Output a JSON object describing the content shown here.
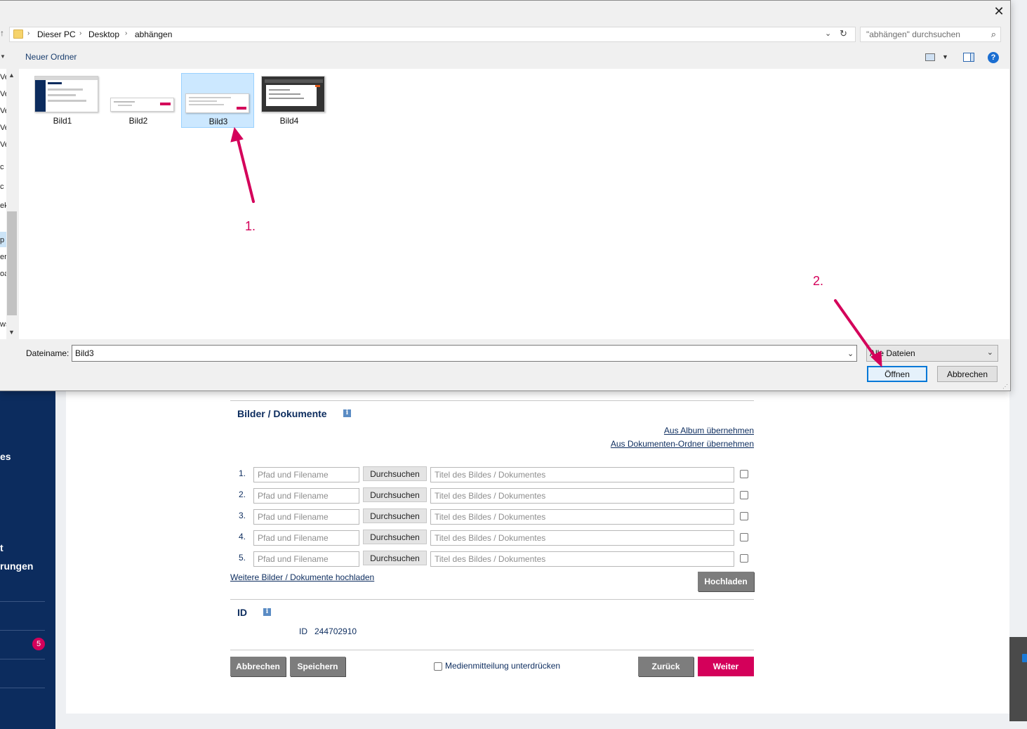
{
  "dialog": {
    "close_glyph": "✕",
    "breadcrumb": [
      "Dieser PC",
      "Desktop",
      "abhängen"
    ],
    "search_placeholder": "\"abhängen\" durchsuchen",
    "new_folder": "Neuer Ordner",
    "help_glyph": "?",
    "sidebar_fragments": [
      "Ve",
      "Ve",
      "Ve",
      "Ve",
      "Ve",
      "c -",
      "c",
      "ek",
      "p",
      "er",
      "oa",
      "ws"
    ],
    "files": [
      {
        "label": "Bild1",
        "selected": false
      },
      {
        "label": "Bild2",
        "selected": false
      },
      {
        "label": "Bild3",
        "selected": true
      },
      {
        "label": "Bild4",
        "selected": false
      }
    ],
    "filename_label": "Dateiname:",
    "filename_value": "Bild3",
    "filter_value": "Alle Dateien",
    "open_button": "Öffnen",
    "cancel_button": "Abbrechen"
  },
  "annotations": {
    "step1": "1.",
    "step2": "2.",
    "color": "#d4005a"
  },
  "nav": {
    "fragments": [
      "es",
      "t",
      "rungen"
    ],
    "badge_count": "5",
    "bg_color": "#0c2c5e"
  },
  "page": {
    "media_section": {
      "title": "Bilder / Dokumente",
      "info": "i",
      "link_album": "Aus Album übernehmen",
      "link_docs": "Aus Dokumenten-Ordner übernehmen",
      "rows": [
        {
          "num": "1.",
          "path_placeholder": "Pfad und Filename",
          "browse": "Durchsuchen",
          "title_placeholder": "Titel des Bildes / Dokumentes"
        },
        {
          "num": "2.",
          "path_placeholder": "Pfad und Filename",
          "browse": "Durchsuchen",
          "title_placeholder": "Titel des Bildes / Dokumentes"
        },
        {
          "num": "3.",
          "path_placeholder": "Pfad und Filename",
          "browse": "Durchsuchen",
          "title_placeholder": "Titel des Bildes / Dokumentes"
        },
        {
          "num": "4.",
          "path_placeholder": "Pfad und Filename",
          "browse": "Durchsuchen",
          "title_placeholder": "Titel des Bildes / Dokumentes"
        },
        {
          "num": "5.",
          "path_placeholder": "Pfad und Filename",
          "browse": "Durchsuchen",
          "title_placeholder": "Titel des Bildes / Dokumentes"
        }
      ],
      "more_link": "Weitere Bilder / Dokumente hochladen",
      "upload_button": "Hochladen"
    },
    "id_section": {
      "title": "ID",
      "info": "i",
      "label": "ID",
      "value": "244702910"
    },
    "footer": {
      "cancel": "Abbrechen",
      "save": "Speichern",
      "suppress_label": "Medienmitteilung unterdrücken",
      "back": "Zurück",
      "next": "Weiter"
    }
  }
}
